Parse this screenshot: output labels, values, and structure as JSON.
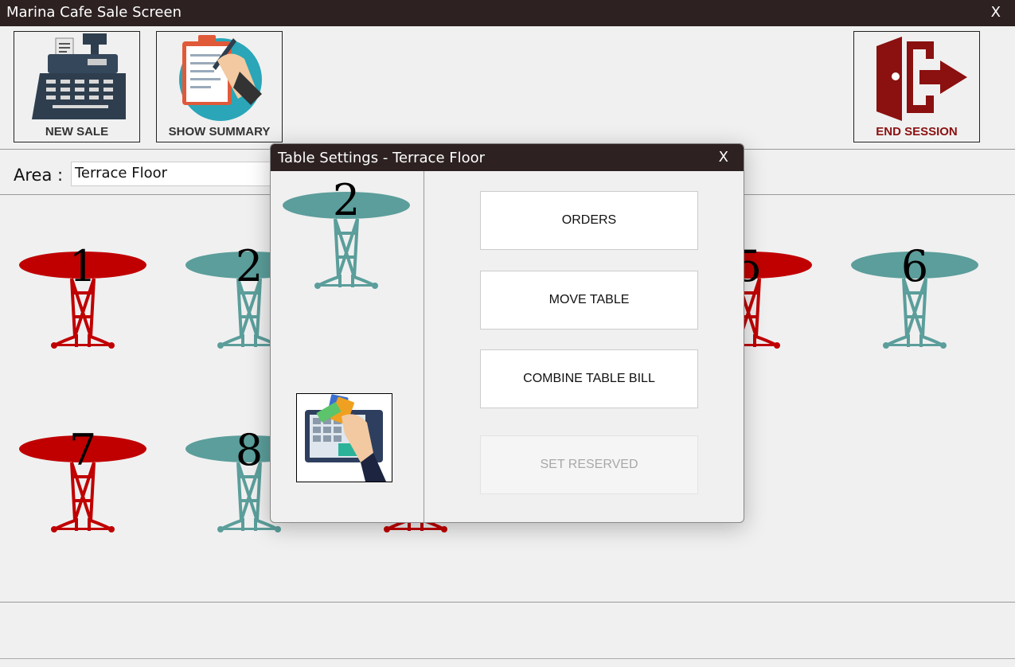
{
  "window": {
    "title": "Marina Cafe Sale Screen",
    "close_label": "X"
  },
  "toolbar": {
    "new_sale_label": "NEW SALE",
    "show_summary_label": "SHOW SUMMARY",
    "end_session_label": "END SESSION"
  },
  "area": {
    "label": "Area :",
    "value": "Terrace Floor"
  },
  "tables": [
    {
      "number": "1",
      "status": "occupied"
    },
    {
      "number": "2",
      "status": "available"
    },
    {
      "number": "5",
      "status": "occupied"
    },
    {
      "number": "6",
      "status": "available"
    },
    {
      "number": "7",
      "status": "occupied"
    },
    {
      "number": "8",
      "status": "available"
    }
  ],
  "colors": {
    "occupied": "#c00000",
    "available": "#5b9e9b",
    "titlebar": "#2d2121",
    "end_session": "#8b1010"
  },
  "dialog": {
    "title": "Table Settings - Terrace Floor",
    "close_label": "X",
    "table_number": "2",
    "buttons": {
      "orders": "ORDERS",
      "move_table": "MOVE TABLE",
      "combine_bill": "COMBINE TABLE BILL",
      "set_reserved": "SET RESERVED"
    }
  }
}
